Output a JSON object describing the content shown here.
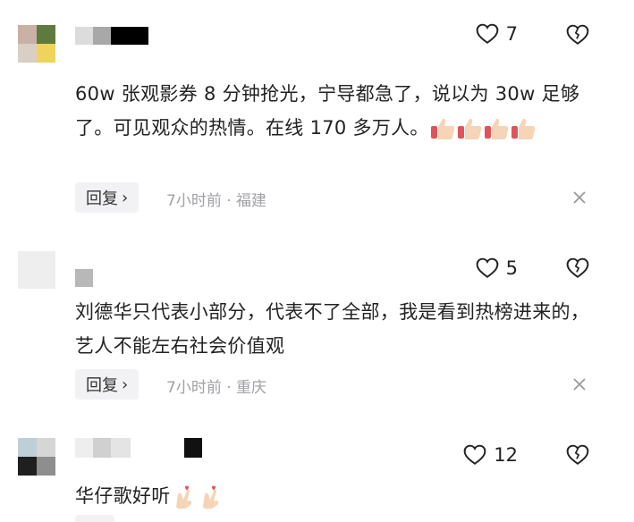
{
  "comments": [
    {
      "text": "60w 张观影券 8 分钟抢光，宁导都急了，说以为 30w 足够了。可见观众的热情。在线 170 多万人。",
      "emoji_count": 4,
      "likes": "7",
      "reply_label": "回复",
      "reply_chevron": "›",
      "meta": "7小时前 · 福建"
    },
    {
      "text": "刘德华只代表小部分，代表不了全部，我是看到热榜进来的，艺人不能左右社会价值观",
      "likes": "5",
      "reply_label": "回复",
      "reply_chevron": "›",
      "meta": "7小时前 · 重庆"
    },
    {
      "text": "华仔歌好听",
      "emoji_count": 2,
      "likes": "12"
    }
  ],
  "colors": {
    "meta": "#a0a0a6",
    "reply_bg": "#f2f2f4",
    "text": "#222222"
  }
}
